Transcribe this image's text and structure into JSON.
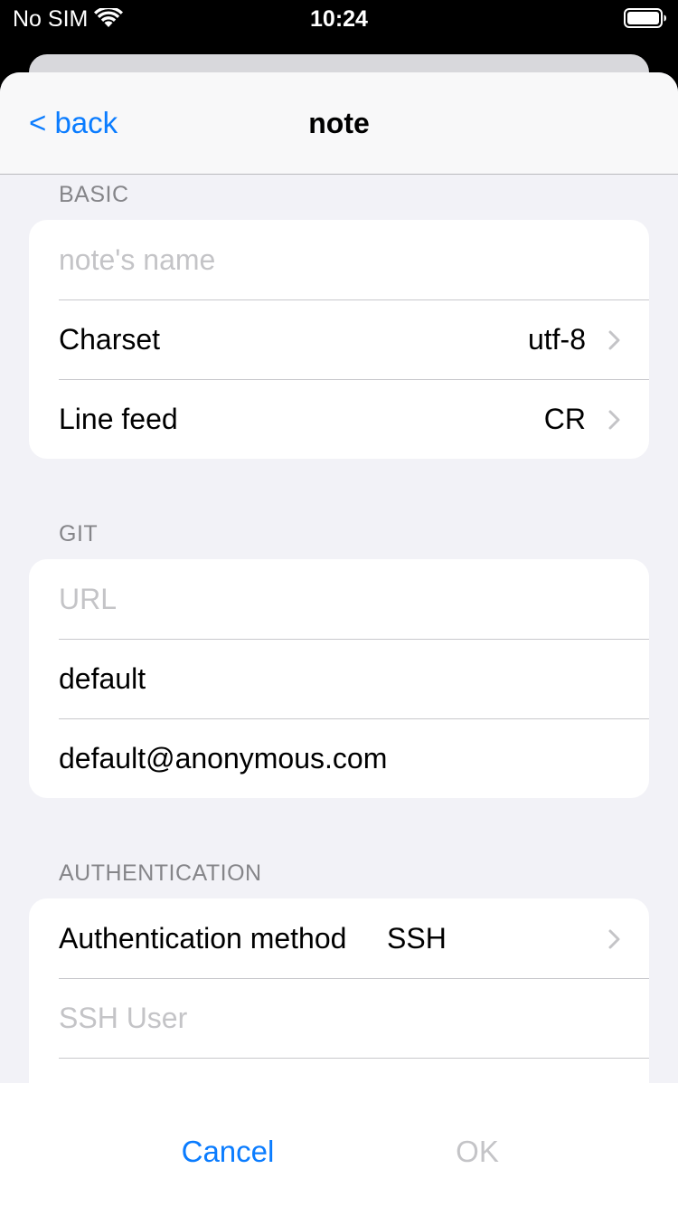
{
  "status_bar": {
    "carrier": "No SIM",
    "time": "10:24",
    "wifi_icon": "wifi-icon",
    "battery_icon": "battery-icon"
  },
  "nav": {
    "back_label": "< back",
    "title": "note"
  },
  "sections": {
    "basic": {
      "header": "BASIC",
      "name_placeholder": "note's name",
      "charset_label": "Charset",
      "charset_value": "utf-8",
      "linefeed_label": "Line feed",
      "linefeed_value": "CR"
    },
    "git": {
      "header": "GIT",
      "url_placeholder": "URL",
      "user_name": "default",
      "user_email": "default@anonymous.com"
    },
    "auth": {
      "header": "AUTHENTICATION",
      "method_label": "Authentication method",
      "method_value": "SSH",
      "ssh_user_placeholder": "SSH User"
    }
  },
  "toolbar": {
    "cancel_label": "Cancel",
    "ok_label": "OK"
  },
  "colors": {
    "accent": "#0a7cff",
    "placeholder": "#c4c4c7",
    "background": "#f2f2f7"
  }
}
